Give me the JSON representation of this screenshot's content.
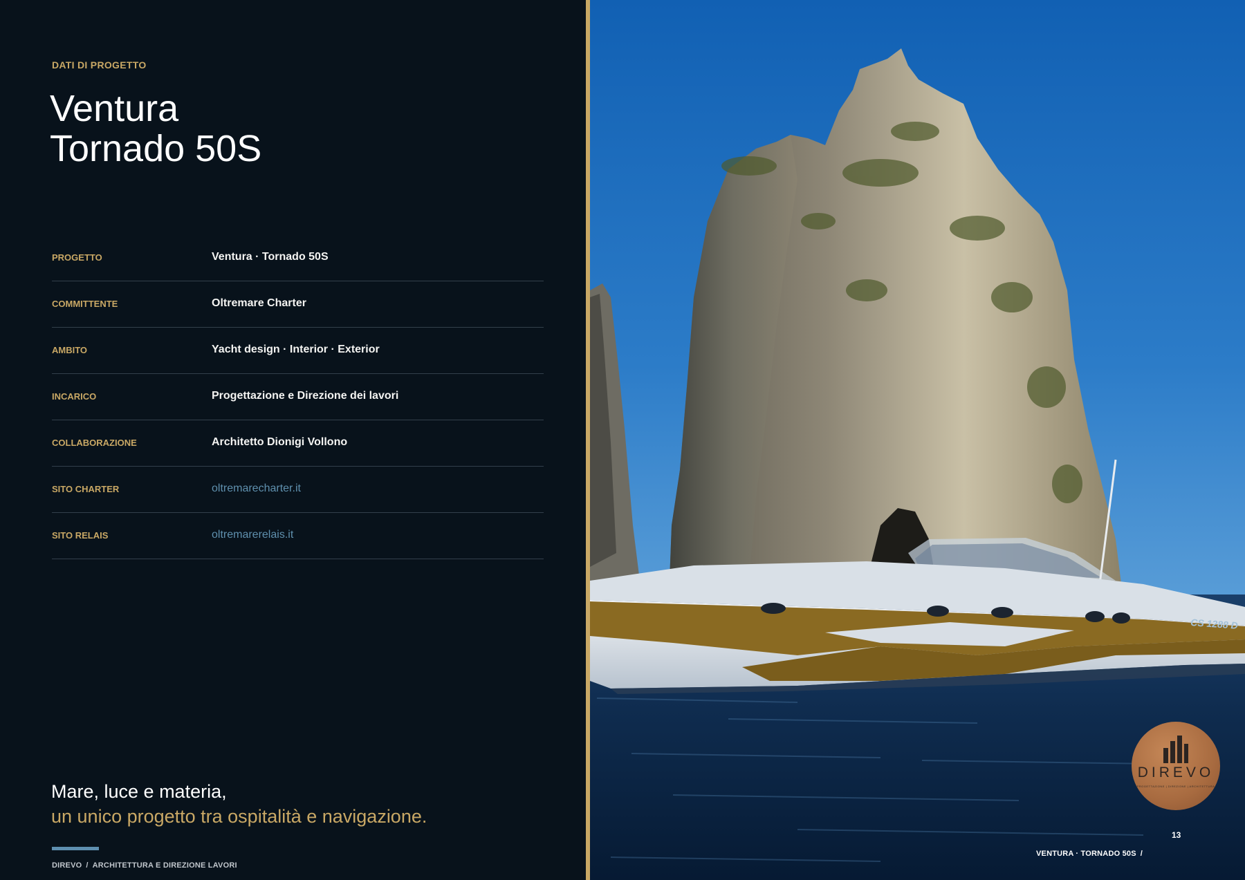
{
  "eyebrow": "DATI DI PROGETTO",
  "title": {
    "line1": "Ventura",
    "line2": "Tornado 50S"
  },
  "facts": [
    {
      "label": "PROGETTO",
      "value": "Ventura · Tornado 50S"
    },
    {
      "label": "COMMITTENTE",
      "value": "Oltremare Charter"
    },
    {
      "label": "AMBITO",
      "value": "Yacht design · Interior · Exterior"
    },
    {
      "label": "INCARICO",
      "value": "Progettazione e Direzione dei lavori"
    },
    {
      "label": "COLLABORAZIONE",
      "value": "Architetto Dionigi Vollono"
    },
    {
      "label": "SITO CHARTER",
      "value": "oltremarecharter.it"
    },
    {
      "label": "SITO RELAIS",
      "value": "oltremarerelais.it"
    }
  ],
  "quote": {
    "line1": "Mare, luce e materia,",
    "line2": "un unico progetto tra ospitalità e navigazione."
  },
  "footer_left": {
    "brand": "DIREVO",
    "separator": "/",
    "section": "ARCHITETTURA E DIREZIONE LAVORI"
  },
  "photo": {
    "subject": "Yacht in front of sea-stack rocks",
    "caption_code": "CS 1288 D"
  },
  "logo": {
    "wordmark": "DIREVO",
    "tagline": "PROGETTAZIONE | DIREZIONE | ARCHITETTURA"
  },
  "page_number": "13",
  "footer_right": {
    "text": "VENTURA · TORNADO 50S",
    "separator": "/"
  },
  "colors": {
    "background": "#08121b",
    "gold": "#c9a865",
    "link_blue": "#5f90ae",
    "rule": "#33404c",
    "logo_copper": "#a86b40"
  }
}
